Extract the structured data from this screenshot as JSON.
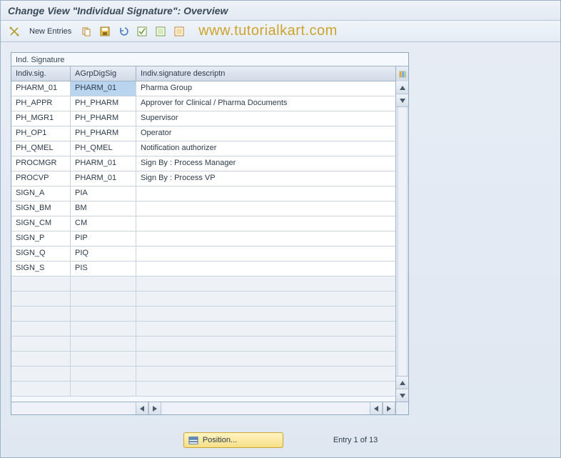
{
  "title": "Change View \"Individual Signature\": Overview",
  "toolbar": {
    "new_entries": "New Entries"
  },
  "watermark": "www.tutorialkart.com",
  "panel": {
    "label": "Ind. Signature",
    "columns": {
      "c1": "Indiv.sig.",
      "c2": "AGrpDigSig",
      "c3": "Indiv.signature descriptn"
    },
    "rows": [
      {
        "sig": "PHARM_01",
        "grp": "PHARM_01",
        "desc": "Pharma Group",
        "selected": true
      },
      {
        "sig": "PH_APPR",
        "grp": "PH_PHARM",
        "desc": "Approver for Clinical / Pharma Documents"
      },
      {
        "sig": "PH_MGR1",
        "grp": "PH_PHARM",
        "desc": "Supervisor"
      },
      {
        "sig": "PH_OP1",
        "grp": "PH_PHARM",
        "desc": "Operator"
      },
      {
        "sig": "PH_QMEL",
        "grp": "PH_QMEL",
        "desc": "Notification authorizer"
      },
      {
        "sig": "PROCMGR",
        "grp": "PHARM_01",
        "desc": "Sign By : Process Manager"
      },
      {
        "sig": "PROCVP",
        "grp": "PHARM_01",
        "desc": "Sign By : Process VP"
      },
      {
        "sig": "SIGN_A",
        "grp": "PIA",
        "desc": ""
      },
      {
        "sig": "SIGN_BM",
        "grp": "BM",
        "desc": ""
      },
      {
        "sig": "SIGN_CM",
        "grp": "CM",
        "desc": ""
      },
      {
        "sig": "SIGN_P",
        "grp": "PIP",
        "desc": ""
      },
      {
        "sig": "SIGN_Q",
        "grp": "PIQ",
        "desc": ""
      },
      {
        "sig": "SIGN_S",
        "grp": "PIS",
        "desc": ""
      }
    ],
    "blank_rows": 8
  },
  "footer": {
    "position_btn": "Position...",
    "entry_text": "Entry 1 of 13"
  }
}
